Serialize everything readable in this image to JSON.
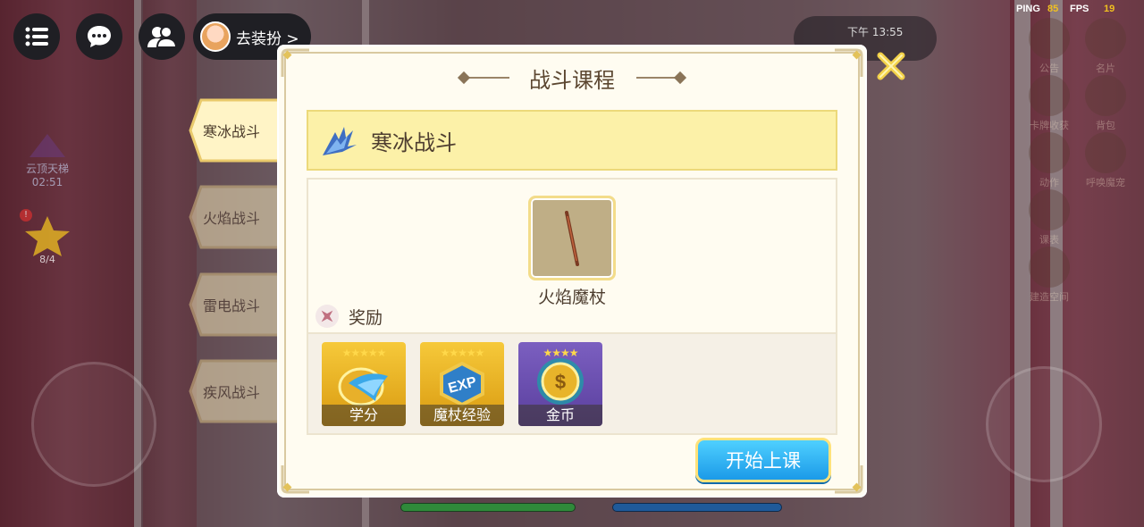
{
  "status": {
    "ping_label": "PING",
    "ping_value": "85",
    "fps_label": "FPS",
    "fps_value": "19"
  },
  "top_left": {
    "dress_up_label": "去装扮 >"
  },
  "background_text": {
    "time": "下午 13:55",
    "yunding": "云顶天梯",
    "yunding_time": "02:51",
    "star_count": "8/4"
  },
  "right_menu": [
    {
      "label": "公告"
    },
    {
      "label": "名片"
    },
    {
      "label": "卡牌收获"
    },
    {
      "label": "背包"
    },
    {
      "label": "动作"
    },
    {
      "label": "呼唤魔宠"
    },
    {
      "label": "课表"
    },
    {
      "label": "建造空间"
    }
  ],
  "dialog": {
    "title": "战斗课程",
    "selected_course": "寒冰战斗",
    "item_name": "火焰魔杖",
    "reward_label": "奖励",
    "rewards": [
      {
        "label": "学分",
        "stars": "★★★★★",
        "icon": "wing-shield-icon"
      },
      {
        "label": "魔杖经验",
        "stars": "★★★★★",
        "icon": "exp-gem-icon"
      },
      {
        "label": "金币",
        "stars": "★★★★",
        "icon": "gold-coin-icon"
      }
    ],
    "start_button": "开始上课"
  },
  "tabs": [
    {
      "label": "寒冰战斗",
      "active": true
    },
    {
      "label": "火焰战斗",
      "active": false
    },
    {
      "label": "雷电战斗",
      "active": false
    },
    {
      "label": "疾风战斗",
      "active": false
    }
  ],
  "colors": {
    "accent_gold": "#f3dc8a",
    "banner": "#fcf1a8",
    "button_blue": "#1b9ae8"
  }
}
